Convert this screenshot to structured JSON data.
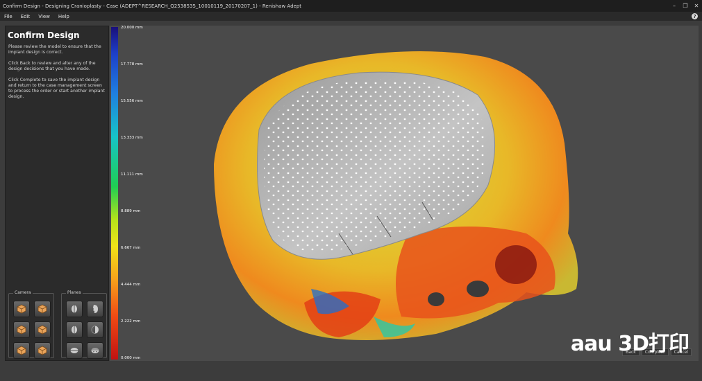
{
  "window": {
    "title": "Confirm Design - Designing Cranioplasty - Case (ADEPT^RESEARCH_Q2538535_10010119_20170207_1) - Renishaw Adept",
    "controls": [
      "–",
      "❐",
      "✕"
    ]
  },
  "menu": {
    "items": [
      "File",
      "Edit",
      "View",
      "Help"
    ],
    "help": "?"
  },
  "panel": {
    "title": "Confirm Design",
    "instructions": [
      "Please review the model to ensure that the implant design is correct.",
      "Click Back to review and alter any of the design decisions that you have made.",
      "Click Complete to save the implant design and return to the case management screen to process the order or start another implant design."
    ],
    "camera_label": "Camera",
    "planes_label": "Planes"
  },
  "colorbar": {
    "ticks": [
      "20.000 mm",
      "17.778 mm",
      "15.556 mm",
      "13.333 mm",
      "11.111 mm",
      "8.889 mm",
      "6.667 mm",
      "4.444 mm",
      "2.222 mm",
      "0.000 mm"
    ]
  },
  "footer": {
    "back": "Back",
    "complete": "Complete",
    "cancel": "Cancel"
  },
  "watermark": "aau 3D打印",
  "colors": {
    "viewport": "#4a4a4a",
    "panel": "#2b2b2b",
    "implant": "#b8b8b8"
  }
}
